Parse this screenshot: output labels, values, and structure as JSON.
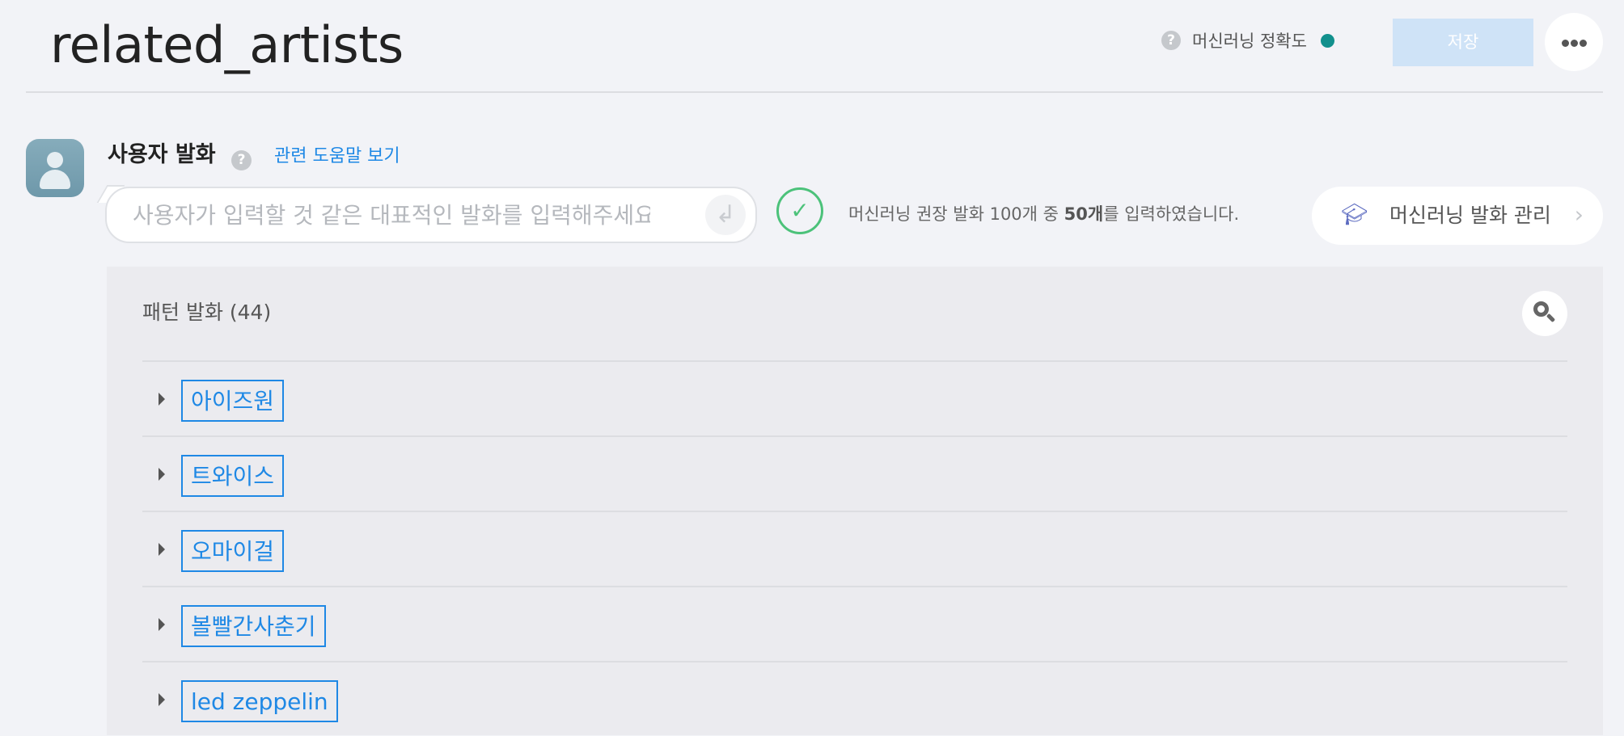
{
  "header": {
    "title": "related_artists",
    "ml_accuracy_label": "머신러닝 정확도",
    "ml_accuracy_color": "#12908d",
    "save_label": "저장",
    "more_icon": "more-horizontal-icon"
  },
  "user_utterance": {
    "section_label": "사용자 발화",
    "help_link": "관련 도움말 보기",
    "input_placeholder": "사용자가 입력할 것 같은 대표적인 발화를 입력해주세요",
    "input_value": "",
    "enter_icon": "enter-icon"
  },
  "ml_status": {
    "text_before": "머신러닝 권장 발화 100개 중 ",
    "count": "50개",
    "text_after": "를 입력하였습니다.",
    "status_color": "#4cc27a"
  },
  "ml_manage": {
    "label": "머신러닝 발화 관리",
    "icon": "graduation-cap-icon"
  },
  "pattern": {
    "title": "패턴 발화 (44)",
    "items": [
      {
        "label": "아이즈원"
      },
      {
        "label": "트와이스"
      },
      {
        "label": "오마이걸"
      },
      {
        "label": "볼빨간사춘기"
      },
      {
        "label": "led zeppelin"
      }
    ]
  },
  "colors": {
    "accent": "#1e88e5",
    "save_disabled": "#cfe3f7",
    "background": "#f2f3f7",
    "panel": "#ebebef"
  }
}
